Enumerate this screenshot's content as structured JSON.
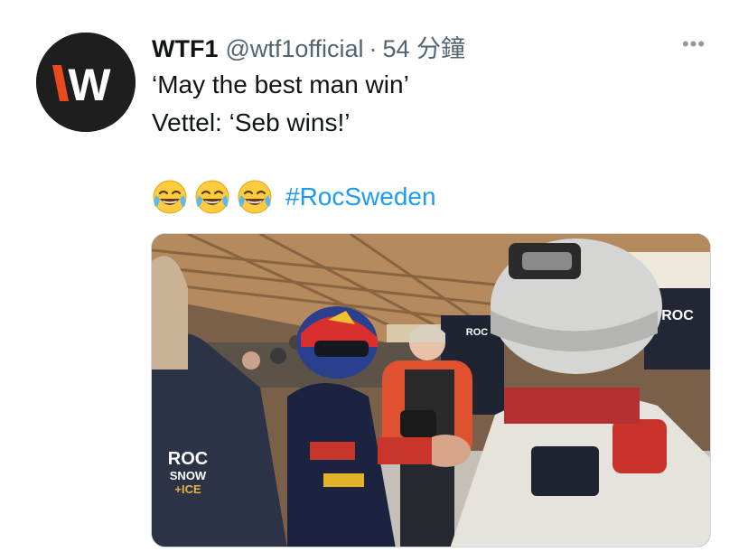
{
  "tweet": {
    "author": {
      "name": "WTF1",
      "handle": "@wtf1official",
      "avatar_icon": "wtf1-logo-icon",
      "avatar_letter": "W"
    },
    "separator": "·",
    "time": "54 分鐘",
    "more_icon": "more-options-icon",
    "more_glyph": "•••",
    "text_lines": [
      "‘May the best man win’",
      "Vettel: ‘Seb wins!’"
    ],
    "emojis": [
      "face-with-tears-of-joy-icon",
      "face-with-tears-of-joy-icon",
      "face-with-tears-of-joy-icon"
    ],
    "hashtag": "#RocSweden",
    "media": {
      "type": "video-still",
      "overlay_texts": [
        "ROC",
        "SNOW",
        "+ICE",
        "ROC",
        "ROC"
      ]
    }
  },
  "colors": {
    "text": "#0f1419",
    "secondary": "#536471",
    "link": "#1d9bf0",
    "avatar_bg": "#1e1e1e",
    "logo_orange": "#e8491d"
  }
}
